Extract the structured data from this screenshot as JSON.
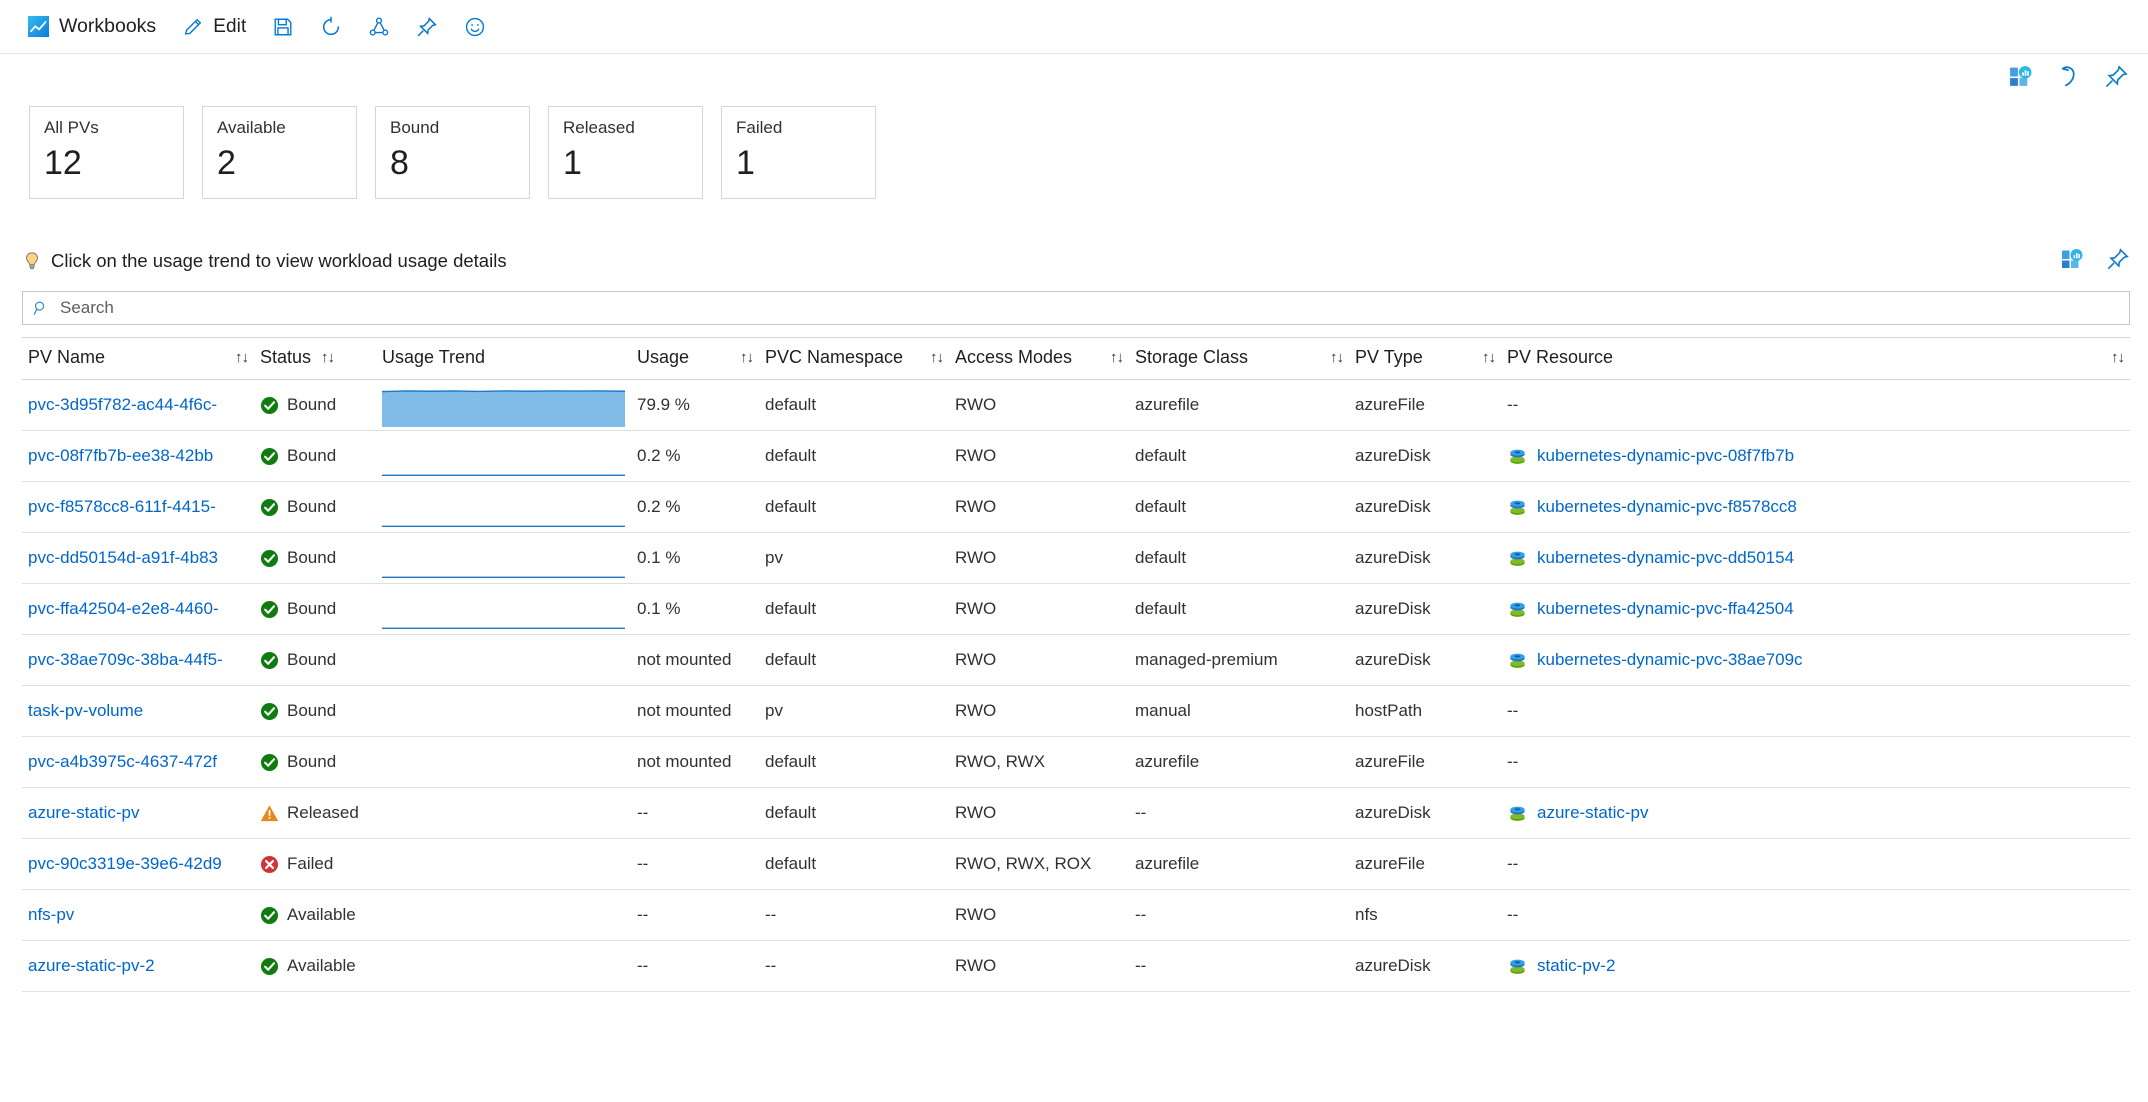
{
  "commandbar": {
    "title": "Workbooks",
    "items": [
      {
        "label": "Edit",
        "icon": "pencil-icon"
      },
      {
        "label": "",
        "icon": "save-icon"
      },
      {
        "label": "",
        "icon": "refresh-icon"
      },
      {
        "label": "",
        "icon": "share-icon"
      },
      {
        "label": "",
        "icon": "pin-icon"
      },
      {
        "label": "",
        "icon": "feedback-smiley-icon"
      }
    ]
  },
  "toolbar_top": {
    "icons": [
      "add-to-dashboard-icon",
      "reset-undo-icon",
      "pin-icon"
    ]
  },
  "tiles": [
    {
      "label": "All PVs",
      "value": "12"
    },
    {
      "label": "Available",
      "value": "2"
    },
    {
      "label": "Bound",
      "value": "8"
    },
    {
      "label": "Released",
      "value": "1"
    },
    {
      "label": "Failed",
      "value": "1"
    }
  ],
  "hint": {
    "text": "Click on the usage trend to view workload usage details",
    "icon": "lightbulb-icon",
    "icons": [
      "add-to-dashboard-icon",
      "pin-icon"
    ]
  },
  "search": {
    "placeholder": "Search",
    "value": "",
    "icon": "search-icon"
  },
  "table": {
    "columns": [
      {
        "label": "PV Name",
        "sortable": true
      },
      {
        "label": "Status",
        "sortable": true
      },
      {
        "label": "Usage Trend",
        "sortable": false
      },
      {
        "label": "Usage",
        "sortable": true
      },
      {
        "label": "PVC Namespace",
        "sortable": true
      },
      {
        "label": "Access Modes",
        "sortable": true
      },
      {
        "label": "Storage Class",
        "sortable": true
      },
      {
        "label": "PV Type",
        "sortable": true
      },
      {
        "label": "PV Resource",
        "sortable": true
      }
    ],
    "sort_glyph": "↑↓",
    "rows": [
      {
        "pv_name": "pvc-3d95f782-ac44-4f6c-",
        "status": "Bound",
        "status_kind": "ok",
        "trend": "area-full",
        "trend_level": 0.86,
        "usage": "79.9 %",
        "pvc_namespace": "default",
        "access_modes": "RWO",
        "storage_class": "azurefile",
        "pv_type": "azureFile",
        "pv_resource": "--",
        "pv_resource_link": false
      },
      {
        "pv_name": "pvc-08f7fb7b-ee38-42bb",
        "status": "Bound",
        "status_kind": "ok",
        "trend": "line-flat",
        "trend_level": 0.04,
        "usage": "0.2 %",
        "pvc_namespace": "default",
        "access_modes": "RWO",
        "storage_class": "default",
        "pv_type": "azureDisk",
        "pv_resource": "kubernetes-dynamic-pvc-08f7fb7b",
        "pv_resource_link": true
      },
      {
        "pv_name": "pvc-f8578cc8-611f-4415-",
        "status": "Bound",
        "status_kind": "ok",
        "trend": "line-flat",
        "trend_level": 0.04,
        "usage": "0.2 %",
        "pvc_namespace": "default",
        "access_modes": "RWO",
        "storage_class": "default",
        "pv_type": "azureDisk",
        "pv_resource": "kubernetes-dynamic-pvc-f8578cc8",
        "pv_resource_link": true
      },
      {
        "pv_name": "pvc-dd50154d-a91f-4b83",
        "status": "Bound",
        "status_kind": "ok",
        "trend": "line-flat",
        "trend_level": 0.04,
        "usage": "0.1 %",
        "pvc_namespace": "pv",
        "access_modes": "RWO",
        "storage_class": "default",
        "pv_type": "azureDisk",
        "pv_resource": "kubernetes-dynamic-pvc-dd50154",
        "pv_resource_link": true
      },
      {
        "pv_name": "pvc-ffa42504-e2e8-4460-",
        "status": "Bound",
        "status_kind": "ok",
        "trend": "line-flat",
        "trend_level": 0.04,
        "usage": "0.1 %",
        "pvc_namespace": "default",
        "access_modes": "RWO",
        "storage_class": "default",
        "pv_type": "azureDisk",
        "pv_resource": "kubernetes-dynamic-pvc-ffa42504",
        "pv_resource_link": true
      },
      {
        "pv_name": "pvc-38ae709c-38ba-44f5-",
        "status": "Bound",
        "status_kind": "ok",
        "trend": "none",
        "trend_level": 0,
        "usage": "not mounted",
        "pvc_namespace": "default",
        "access_modes": "RWO",
        "storage_class": "managed-premium",
        "pv_type": "azureDisk",
        "pv_resource": "kubernetes-dynamic-pvc-38ae709c",
        "pv_resource_link": true
      },
      {
        "pv_name": "task-pv-volume",
        "status": "Bound",
        "status_kind": "ok",
        "trend": "none",
        "trend_level": 0,
        "usage": "not mounted",
        "pvc_namespace": "pv",
        "access_modes": "RWO",
        "storage_class": "manual",
        "pv_type": "hostPath",
        "pv_resource": "--",
        "pv_resource_link": false
      },
      {
        "pv_name": "pvc-a4b3975c-4637-472f",
        "status": "Bound",
        "status_kind": "ok",
        "trend": "none",
        "trend_level": 0,
        "usage": "not mounted",
        "pvc_namespace": "default",
        "access_modes": "RWO, RWX",
        "storage_class": "azurefile",
        "pv_type": "azureFile",
        "pv_resource": "--",
        "pv_resource_link": false
      },
      {
        "pv_name": "azure-static-pv",
        "status": "Released",
        "status_kind": "warn",
        "trend": "none",
        "trend_level": 0,
        "usage": "--",
        "pvc_namespace": "default",
        "access_modes": "RWO",
        "storage_class": "--",
        "pv_type": "azureDisk",
        "pv_resource": "azure-static-pv",
        "pv_resource_link": true
      },
      {
        "pv_name": "pvc-90c3319e-39e6-42d9",
        "status": "Failed",
        "status_kind": "error",
        "trend": "none",
        "trend_level": 0,
        "usage": "--",
        "pvc_namespace": "default",
        "access_modes": "RWO, RWX, ROX",
        "storage_class": "azurefile",
        "pv_type": "azureFile",
        "pv_resource": "--",
        "pv_resource_link": false
      },
      {
        "pv_name": "nfs-pv",
        "status": "Available",
        "status_kind": "ok",
        "trend": "none",
        "trend_level": 0,
        "usage": "--",
        "pvc_namespace": "--",
        "access_modes": "RWO",
        "storage_class": "--",
        "pv_type": "nfs",
        "pv_resource": "--",
        "pv_resource_link": false
      },
      {
        "pv_name": "azure-static-pv-2",
        "status": "Available",
        "status_kind": "ok",
        "trend": "none",
        "trend_level": 0,
        "usage": "--",
        "pvc_namespace": "--",
        "access_modes": "RWO",
        "storage_class": "--",
        "pv_type": "azureDisk",
        "pv_resource": "static-pv-2",
        "pv_resource_link": true
      }
    ]
  },
  "colors": {
    "link": "#0066cc",
    "accent": "#0078d4",
    "area_fill": "#81bbe8",
    "area_stroke": "#1a7ac9",
    "ok": "#107c10",
    "warn": "#e8871a",
    "error": "#d13438",
    "border": "#d6d6d6",
    "row_border": "#e1dfdd"
  }
}
